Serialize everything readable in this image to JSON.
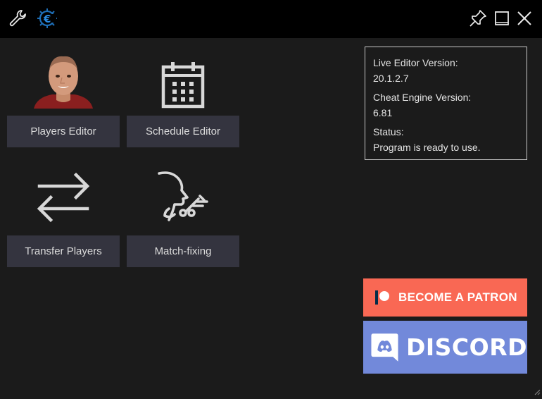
{
  "titlebar": {
    "icons": [
      "wrench-icon",
      "cheat-engine-logo",
      "pin-icon",
      "maximize-icon",
      "close-icon"
    ]
  },
  "tiles": [
    {
      "label": "Players Editor",
      "icon": "player-photo"
    },
    {
      "label": "Schedule Editor",
      "icon": "calendar-icon"
    },
    {
      "label": "Transfer Players",
      "icon": "transfer-arrows-icon"
    },
    {
      "label": "Match-fixing",
      "icon": "match-fixing-icon"
    }
  ],
  "info": {
    "live_editor_label": "Live Editor Version:",
    "live_editor_version": "20.1.2.7",
    "cheat_engine_label": "Cheat Engine Version:",
    "cheat_engine_version": "6.81",
    "status_label": "Status:",
    "status_text": "Program is ready to use."
  },
  "patreon": {
    "label": "BECOME A PATRON",
    "color": "#f96854"
  },
  "discord": {
    "label": "DISCORD",
    "color": "#7289da"
  },
  "colors": {
    "background": "#1b1b1b",
    "titlebar": "#000000",
    "tile_button": "#34343f"
  }
}
